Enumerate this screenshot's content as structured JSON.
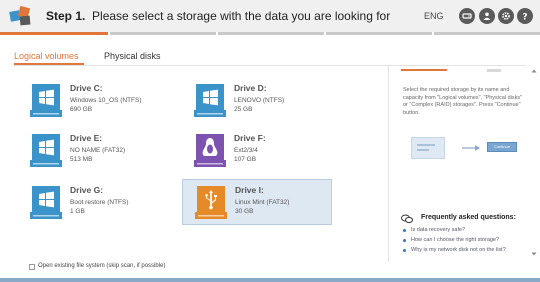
{
  "header": {
    "step_label": "Step 1.",
    "instruction": "Please select a storage with the data you are looking for",
    "language": "ENG",
    "icons": [
      "drive-icon",
      "user-icon",
      "gear-icon",
      "help-icon"
    ],
    "progress_fraction": 0.2
  },
  "tabs": [
    {
      "label": "Logical volumes",
      "active": true
    },
    {
      "label": "Physical disks",
      "active": false
    }
  ],
  "drives": [
    {
      "name": "Drive C:",
      "fs": "Windows 10_OS (NTFS)",
      "size": "690 GB",
      "icon": "windows-drive-icon",
      "selected": false
    },
    {
      "name": "Drive D:",
      "fs": "LENOVO (NTFS)",
      "size": "25 GB",
      "icon": "windows-drive-icon",
      "selected": false
    },
    {
      "name": "Drive E:",
      "fs": "NO NAME (FAT32)",
      "size": "513 MB",
      "icon": "windows-drive-icon",
      "selected": false
    },
    {
      "name": "Drive F:",
      "fs": "Ext2/3/4",
      "size": "107 GB",
      "icon": "linux-drive-icon",
      "selected": false
    },
    {
      "name": "Drive G:",
      "fs": "Boot restore (NTFS)",
      "size": "1 GB",
      "icon": "windows-drive-icon",
      "selected": false
    },
    {
      "name": "Drive I:",
      "fs": "Linux Mint (FAT32)",
      "size": "30 GB",
      "icon": "usb-drive-icon",
      "selected": true
    }
  ],
  "help_panel": {
    "description": "Select the required storage by its name and capacity from \"Logical volumes\", \"Physical disks\" or \"Complex (RAID) storages\". Press \"Continue\" button.",
    "illustration_button": "Continue",
    "faq_title": "Frequently asked questions:",
    "faq_items": [
      "Is data recovery safe?",
      "How can I choose the right storage?",
      "Why is my network disk not on the list?"
    ]
  },
  "footer": {
    "checkbox_label": "Open existing file system (skip scan, if possible)",
    "checkbox_checked": false
  },
  "colors": {
    "accent": "#e0763a",
    "windows_drive": "#3a93c9",
    "linux_drive": "#7d52b1",
    "usb_drive": "#e58a26",
    "selected_bg": "#dde8f3"
  }
}
